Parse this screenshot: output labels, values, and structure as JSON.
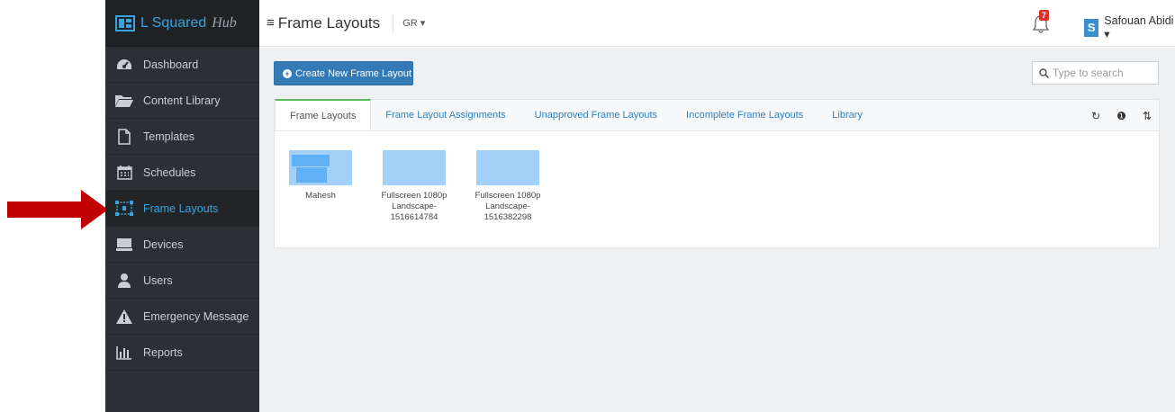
{
  "brand": {
    "name": "L Squared",
    "suffix": "Hub"
  },
  "sidebar": {
    "items": [
      {
        "label": "Dashboard",
        "icon": "dashboard-icon"
      },
      {
        "label": "Content Library",
        "icon": "folder-icon"
      },
      {
        "label": "Templates",
        "icon": "file-icon"
      },
      {
        "label": "Schedules",
        "icon": "calendar-icon"
      },
      {
        "label": "Frame Layouts",
        "icon": "frame-layout-icon",
        "active": true
      },
      {
        "label": "Devices",
        "icon": "device-icon"
      },
      {
        "label": "Users",
        "icon": "user-icon"
      },
      {
        "label": "Emergency Message",
        "icon": "warning-icon"
      },
      {
        "label": "Reports",
        "icon": "bar-chart-icon"
      }
    ]
  },
  "header": {
    "title": "Frame Layouts",
    "menu_symbol": "≡",
    "group": "GR ▾",
    "notifications_count": "7",
    "user_initial": "S",
    "user_name": "Safouan Abidi ▾"
  },
  "main": {
    "create_button": "Create New Frame Layout",
    "search_placeholder": "Type to search",
    "tabs": [
      {
        "label": "Frame Layouts",
        "active": true
      },
      {
        "label": "Frame Layout Assignments"
      },
      {
        "label": "Unapproved Frame Layouts"
      },
      {
        "label": "Incomplete Frame Layouts"
      },
      {
        "label": "Library"
      }
    ],
    "tools": {
      "refresh": "↻",
      "info": "❶",
      "sort": "⇅"
    },
    "layouts": [
      {
        "name": "Mahesh"
      },
      {
        "name": "Fullscreen 1080p Landscape-1516614784"
      },
      {
        "name": "Fullscreen 1080p Landscape-1516382298"
      }
    ]
  },
  "colors": {
    "accent": "#3aa3df",
    "sidebar": "#2c2f33",
    "button": "#337ab7",
    "thumbnail": "#a3d0f7",
    "annotation_arrow": "#c00000"
  }
}
